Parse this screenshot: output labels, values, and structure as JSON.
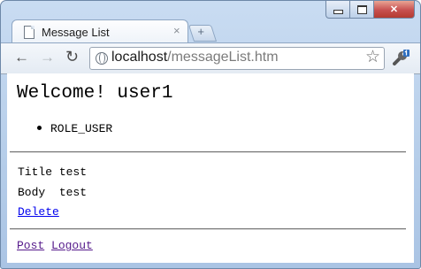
{
  "browser": {
    "tab_title": "Message List",
    "tab_close": "×",
    "new_tab": "+",
    "url_host": "localhost",
    "url_path": "/messageList.htm",
    "back": "←",
    "forward": "→",
    "reload": "↻",
    "star": "☆"
  },
  "page": {
    "welcome": "Welcome! user1",
    "roles": [
      "ROLE_USER"
    ],
    "message": {
      "title_label": "Title",
      "title_value": "test",
      "body_label": "Body",
      "body_value": "test",
      "delete_label": "Delete"
    },
    "footer": {
      "post_label": "Post",
      "logout_label": "Logout"
    }
  },
  "colors": {
    "link": "#0000ee",
    "visited_link": "#551a8b",
    "close_button": "#c75050"
  }
}
